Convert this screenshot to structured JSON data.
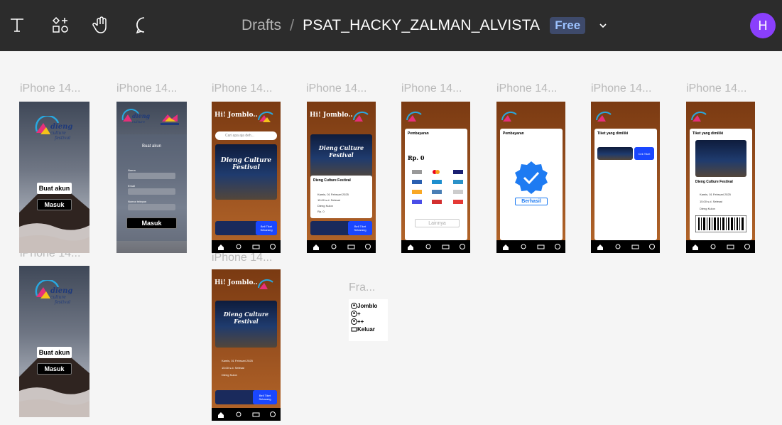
{
  "toolbar": {
    "tools": [
      {
        "name": "text-tool",
        "icon": "text-icon"
      },
      {
        "name": "shapes-tool",
        "icon": "shapes-icon"
      },
      {
        "name": "hand-tool",
        "icon": "hand-icon"
      },
      {
        "name": "comment-tool",
        "icon": "comment-icon"
      }
    ],
    "breadcrumb_root": "Drafts",
    "separator": "/",
    "file_name": "PSAT_HACKY_ZALMAN_ALVISTA",
    "plan_badge": "Free",
    "avatar_letter": "H",
    "avatar_color": "#8a3ffc"
  },
  "frames": {
    "label": "iPhone 14...",
    "small_frame_label": "Fra...",
    "f1": {
      "create_account": "Buat akun",
      "login": "Masuk"
    },
    "f2": {
      "title": "Buat akun",
      "field_name": "Nama",
      "field_email": "Email",
      "field_phone": "Nomor telepon",
      "login": "Masuk"
    },
    "f3": {
      "greeting": "Hi! Jomblo..",
      "search_placeholder": "Cari apa aja deh...",
      "poster_title": "Dieng Culture Festival",
      "buy_cta": "Beli Tiket Sekarang"
    },
    "f4": {
      "greeting": "Hi! Jomblo..",
      "event_title": "Dieng Culture Festival",
      "date": "Kamis, 01 Februari 2025",
      "time": "15.00 s.d. Selesai",
      "place": "Dieng Kulon",
      "price": "Rp. 0",
      "buy_cta": "Beli Tiket Sekarang"
    },
    "f5": {
      "header": "Pembayaran",
      "amount": "Rp. 0",
      "other": "Lainnya"
    },
    "f6": {
      "header": "Pembayaran",
      "status": "Berhasil"
    },
    "f7": {
      "header": "Tiket yang dimiliki",
      "check_btn": "Cek Tiket"
    },
    "f8": {
      "header": "Tiket yang dimiliki",
      "event_title": "Dieng Culture Festival",
      "date": "Kamis, 01 Februari 2025",
      "time": "15.00 s.d. Selesai",
      "place": "Dieng Kulon"
    },
    "f9": {
      "create_account": "Buat akun",
      "login": "Masuk"
    },
    "f10": {
      "greeting": "Hi! Jomblo..",
      "poster_title": "Dieng Culture Festival",
      "date": "Kamis, 01 Februari 2025",
      "time": "15.00 s.d. Selesai",
      "place": "Dieng Kulon",
      "buy_cta": "Beli Tiket Sekarang"
    },
    "menu": [
      {
        "icon": "user-icon",
        "label": "Jomblo"
      },
      {
        "icon": "user-icon",
        "label": "+"
      },
      {
        "icon": "user-icon",
        "label": "++"
      },
      {
        "icon": "logout-icon",
        "label": "Keluar"
      }
    ]
  },
  "colors": {
    "toolbar": "#2c2c2c",
    "canvas": "#f5f5f5",
    "brown": "#9b5220",
    "accent": "#1a47ff"
  }
}
